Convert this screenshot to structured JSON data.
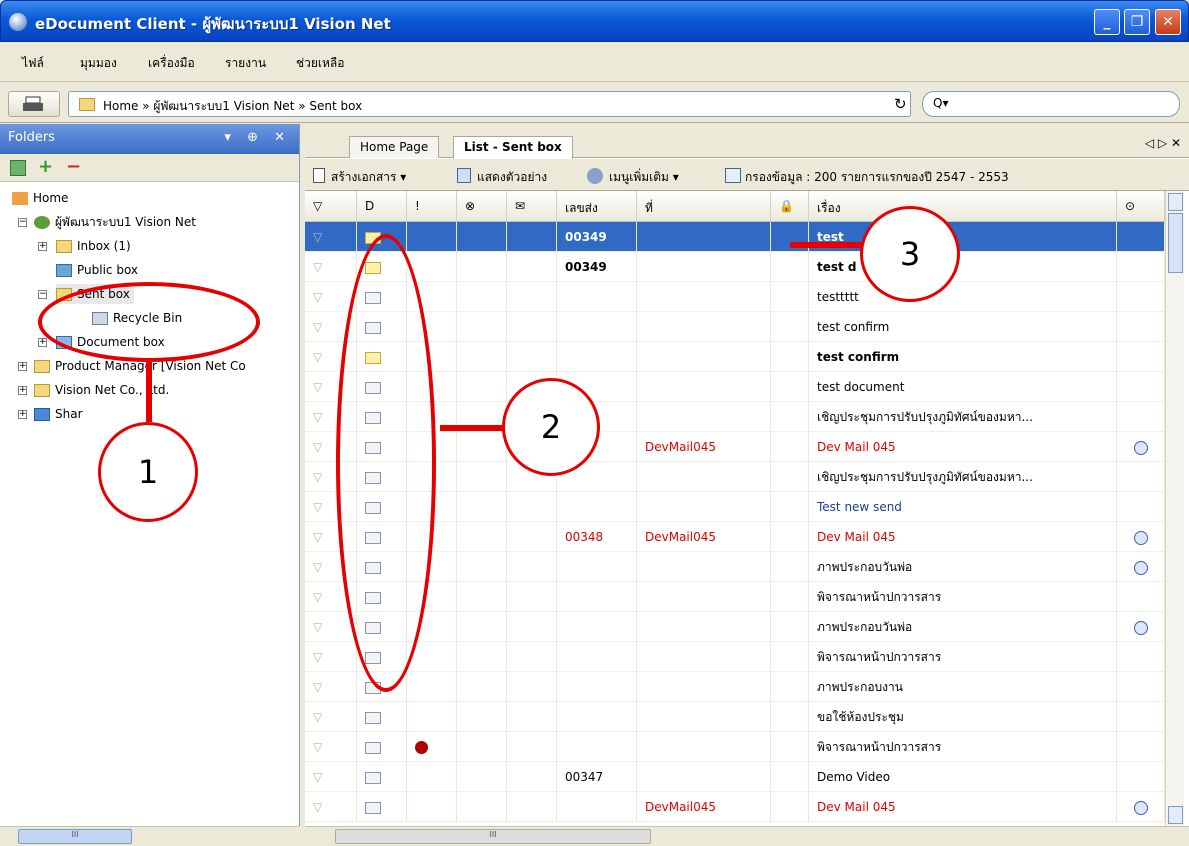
{
  "window": {
    "title": "eDocument Client - ผู้พัฒนาระบบ1 Vision Net",
    "buttons": [
      "_",
      "❐",
      "✕"
    ]
  },
  "menu": [
    "ไฟล์",
    "มุมมอง",
    "เครื่องมือ",
    "รายงาน",
    "ช่วยเหลือ"
  ],
  "address": {
    "path": "Home » ผู้พัฒนาระบบ1 Vision Net » Sent box",
    "search_placeholder": "Q▾"
  },
  "folders": {
    "title": "Folders",
    "header_controls": "▾ ⊕ ✕",
    "tree": [
      {
        "label": "Home"
      },
      {
        "label": "ผู้พัฒนาระบบ1 Vision Net"
      },
      {
        "label": "Inbox (1)"
      },
      {
        "label": "Public box"
      },
      {
        "label": "Sent box"
      },
      {
        "label": "Recycle Bin"
      },
      {
        "label": "Document box"
      },
      {
        "label": "Product Manager [Vision Net Co"
      },
      {
        "label": "Vision Net Co., Ltd."
      },
      {
        "label": "Shar"
      }
    ]
  },
  "tabs": [
    "Home Page",
    "List - Sent box"
  ],
  "tab_controls": "◁ ▷ ✕",
  "toolbar": {
    "create": "สร้างเอกสาร ▾",
    "preview": "แสดงตัวอย่าง",
    "more": "เมนูเพิ่มเติม ▾",
    "filter": "กรองข้อมูล : 200 รายการแรกของปี 2547 - 2553"
  },
  "columns": [
    "▽",
    "D",
    "!",
    "⊗",
    "✉",
    "เลขส่ง",
    "ที่",
    "🔒",
    "เรื่อง",
    "⊙"
  ],
  "rows": [
    {
      "num": "00349",
      "at": "",
      "subject": "test",
      "icon": "unread",
      "sel": true,
      "bold": true
    },
    {
      "num": "00349",
      "at": "",
      "subject": "test d",
      "icon": "unread",
      "bold": true
    },
    {
      "num": "",
      "at": "",
      "subject": "testtttt",
      "icon": "open"
    },
    {
      "num": "",
      "at": "",
      "subject": "test confirm",
      "icon": "doc"
    },
    {
      "num": "",
      "at": "",
      "subject": "test confirm",
      "icon": "unread",
      "bold": true
    },
    {
      "num": "",
      "at": "",
      "subject": "test document",
      "icon": "open"
    },
    {
      "num": "",
      "at": "",
      "subject": "เชิญประชุมการปรับปรุงภูมิทัศน์ของมหา...",
      "icon": "doc"
    },
    {
      "num": "",
      "at": "DevMail045",
      "subject": "Dev Mail 045",
      "icon": "open",
      "red": true,
      "clock": true
    },
    {
      "num": "",
      "at": "",
      "subject": "เชิญประชุมการปรับปรุงภูมิทัศน์ของมหา...",
      "icon": "fwd"
    },
    {
      "num": "",
      "at": "",
      "subject": "Test new send",
      "icon": "fwd",
      "blue": true
    },
    {
      "num": "00348",
      "at": "DevMail045",
      "subject": "Dev Mail 045",
      "icon": "doc",
      "red": true,
      "clock": true
    },
    {
      "num": "",
      "at": "",
      "subject": "ภาพประกอบวันพ่อ",
      "icon": "fwd",
      "clock": true
    },
    {
      "num": "",
      "at": "",
      "subject": "พิจารณาหน้าปกวารสาร",
      "icon": "fwd"
    },
    {
      "num": "",
      "at": "",
      "subject": "ภาพประกอบวันพ่อ",
      "icon": "fwd",
      "clock": true
    },
    {
      "num": "",
      "at": "",
      "subject": "พิจารณาหน้าปกวารสาร",
      "icon": "fwd"
    },
    {
      "num": "",
      "at": "",
      "subject": "ภาพประกอบงาน",
      "icon": "doc"
    },
    {
      "num": "",
      "at": "",
      "subject": "ขอใช้ห้องประชุม",
      "icon": "doc"
    },
    {
      "num": "",
      "at": "",
      "subject": "พิจารณาหน้าปกวารสาร",
      "icon": "fwd",
      "priority": true
    },
    {
      "num": "00347",
      "at": "",
      "subject": "Demo Video",
      "icon": "doc"
    },
    {
      "num": "",
      "at": "DevMail045",
      "subject": "Dev Mail 045",
      "icon": "fwd",
      "red": true,
      "clock": true
    }
  ],
  "annotations": [
    "1",
    "2",
    "3"
  ],
  "scroll": {
    "h_mark": "III"
  }
}
